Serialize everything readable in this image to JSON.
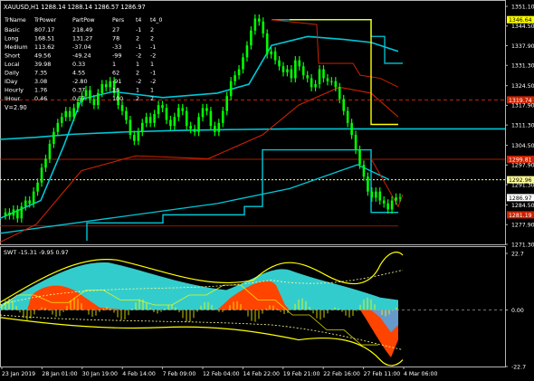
{
  "window": {
    "symbol_header": "XAUUSD,H1  1288.14 1288.14 1286.57 1286.97"
  },
  "table": {
    "headers": [
      "TrName",
      "TrPower",
      "PartPow",
      "Pers",
      "t4",
      "t4_0"
    ],
    "rows": [
      [
        "Basic",
        "807.17",
        "218.49",
        "27",
        "-1",
        "2"
      ],
      [
        "Long",
        "168.51",
        "131.27",
        "78",
        "2",
        "2"
      ],
      [
        "Medium",
        "113.62",
        "-37.04",
        "-33",
        "-1",
        "-1"
      ],
      [
        "Short",
        "49.56",
        "-49.24",
        "-99",
        "-2",
        "-2"
      ],
      [
        "Local",
        "39.98",
        "0.33",
        "1",
        "1",
        "1"
      ],
      [
        "Daily",
        "7.35",
        "4.55",
        "62",
        "2",
        "-1"
      ],
      [
        "IDay",
        "3.08",
        "-2.80",
        "-91",
        "-2",
        "-2"
      ],
      [
        "Hourly",
        "1.76",
        "0.37",
        "16",
        "1",
        "1"
      ],
      [
        "IHour",
        "0.46",
        "0.57",
        "100",
        "2",
        "2"
      ]
    ],
    "v_line": "V=2.90"
  },
  "main_axis": {
    "ticks": [
      "1351.10",
      "1344.50",
      "1337.90",
      "1331.30",
      "1324.50",
      "1317.90",
      "1311.30",
      "1304.50",
      "1297.90",
      "1291.30",
      "1284.50",
      "1277.90",
      "1271.30"
    ],
    "ylim": [
      1271.3,
      1351.1
    ]
  },
  "price_labels": [
    {
      "value": "1346.64",
      "price": 1346.64,
      "color": "#ffff00",
      "text_color": "#000000"
    },
    {
      "value": "1319.74",
      "price": 1319.74,
      "color": "#cc2200",
      "text_color": "#ffffff"
    },
    {
      "value": "1299.81",
      "price": 1299.81,
      "color": "#cc2200",
      "text_color": "#ffffff"
    },
    {
      "value": "1292.96",
      "price": 1292.96,
      "color": "#ffff99",
      "text_color": "#000000"
    },
    {
      "value": "1286.97",
      "price": 1286.97,
      "color": "#ffffff",
      "text_color": "#000000"
    },
    {
      "value": "1281.19",
      "price": 1281.19,
      "color": "#cc2200",
      "text_color": "#ffffff"
    }
  ],
  "sub_window": {
    "label": "SWT -15.31 -9.95 0.97",
    "ticks": [
      "22.7",
      "0.00",
      "-22.7"
    ],
    "ylim": [
      -22.7,
      22.7
    ]
  },
  "time_axis": {
    "labels": [
      "23 Jan 2019",
      "28 Jan 01:00",
      "30 Jan 19:00",
      "4 Feb 14:00",
      "7 Feb 09:00",
      "12 Feb 04:00",
      "14 Feb 22:00",
      "19 Feb 21:00",
      "22 Feb 16:00",
      "27 Feb 11:00",
      "4 Mar 06:00"
    ]
  },
  "colors": {
    "background": "#000000",
    "candles": "#00ff00",
    "grid": "#c0c0c0",
    "cyan": "#00c8d8",
    "trend_red": "#cc2200",
    "yellow": "#ffff00",
    "area_cyan": "#33cccc",
    "area_red": "#ff4400",
    "area_blue": "#6699cc"
  },
  "chart_data": {
    "type": "line",
    "series": [
      {
        "values": [
          1282,
          1281,
          1283,
          1280,
          1284,
          1286,
          1285,
          1289,
          1292,
          1297,
          1300,
          1305,
          1309,
          1312,
          1314,
          1316,
          1314,
          1317,
          1319,
          1321,
          1323,
          1320,
          1318,
          1322,
          1325,
          1324,
          1326,
          1322,
          1318,
          1316,
          1313,
          1308,
          1306,
          1309,
          1312,
          1314,
          1312,
          1315,
          1318,
          1317,
          1313,
          1311,
          1314,
          1317,
          1316,
          1311,
          1310,
          1309,
          1314,
          1317,
          1316,
          1311,
          1309,
          1312,
          1316,
          1321,
          1326,
          1328,
          1330,
          1334,
          1338,
          1343,
          1347,
          1346,
          1342,
          1335,
          1336,
          1333,
          1331,
          1329,
          1330,
          1327,
          1333,
          1331,
          1328,
          1327,
          1324,
          1325,
          1330,
          1327,
          1326,
          1326,
          1324,
          1320,
          1316,
          1312,
          1308,
          1303,
          1298,
          1294,
          1289,
          1287,
          1289,
          1286,
          1285,
          1283,
          1286,
          1287,
          1287
        ]
      }
    ]
  }
}
